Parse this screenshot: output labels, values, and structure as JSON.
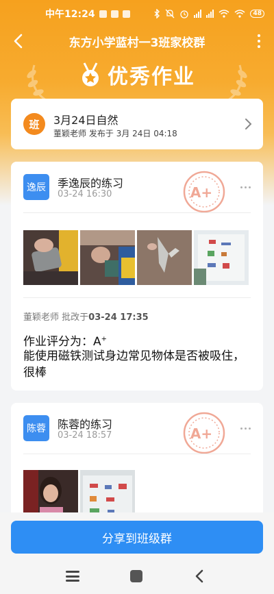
{
  "status_bar": {
    "time": "中午12:24",
    "battery": "48"
  },
  "nav": {
    "title": "东方小学蓝村一3班家校群"
  },
  "banner": {
    "title": "优秀作业"
  },
  "assignment": {
    "avatar_text": "班",
    "title": "3月24日自然",
    "teacher": "董颖老师",
    "publish_label": "发布于",
    "publish_time": "3月 24日 04:18"
  },
  "submissions": [
    {
      "avatar_text": "逸辰",
      "name": "季逸辰的练习",
      "time": "03-24 16:30",
      "stamp": "A+",
      "review": {
        "teacher": "董颖老师",
        "action": "批改于",
        "time": "03-24 17:35",
        "grade_prefix": "作业评分为：",
        "grade": "A",
        "grade_sup": "+",
        "comment": "能使用磁铁测试身边常见物体是否被吸住，很棒"
      }
    },
    {
      "avatar_text": "陈蓉",
      "name": "陈蓉的练习",
      "time": "03-24 18:57",
      "stamp": "A+"
    }
  ],
  "share_button": "分享到班级群",
  "colors": {
    "orange": "#f6a11e",
    "blue": "#2e8ef4",
    "avatar_orange": "#f38a1e",
    "stamp": "#f0a896"
  }
}
